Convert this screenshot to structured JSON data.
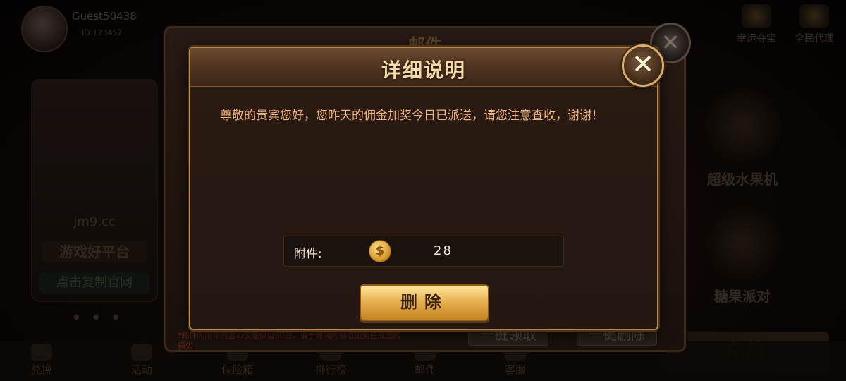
{
  "lobby": {
    "user": {
      "name": "Guest50438",
      "id": "ID:123452"
    },
    "top_right": [
      {
        "label": "幸运夺宝",
        "icon": "treasure-icon"
      },
      {
        "label": "全民代理",
        "icon": "crown-icon"
      }
    ],
    "promo": {
      "site": "jm9.cc",
      "slogan": "游戏好平台",
      "copy_button": "点击复制官网"
    },
    "games": [
      {
        "label": "超级水果机",
        "icon": "slot-machine-icon"
      },
      {
        "label": "糖果派对",
        "icon": "candy-icon"
      }
    ],
    "recharge": "充值",
    "nav": [
      "兑换",
      "活动",
      "保险箱",
      "排行榜",
      "邮件",
      "客服"
    ]
  },
  "mail": {
    "title": "邮件",
    "note": "*邮件内附带的金币仅能保留30日，请于时间内领取避免造成您的损失",
    "claim_all": "一键领取",
    "delete_all": "一键删除"
  },
  "detail": {
    "title": "详细说明",
    "message": "尊敬的贵宾您好，您昨天的佣金加奖今日已派送，请您注意查收，谢谢！",
    "attachment_label": "附件:",
    "attachment_icon": "gold-coin-icon",
    "attachment_amount": "28",
    "delete_label": "删除"
  }
}
